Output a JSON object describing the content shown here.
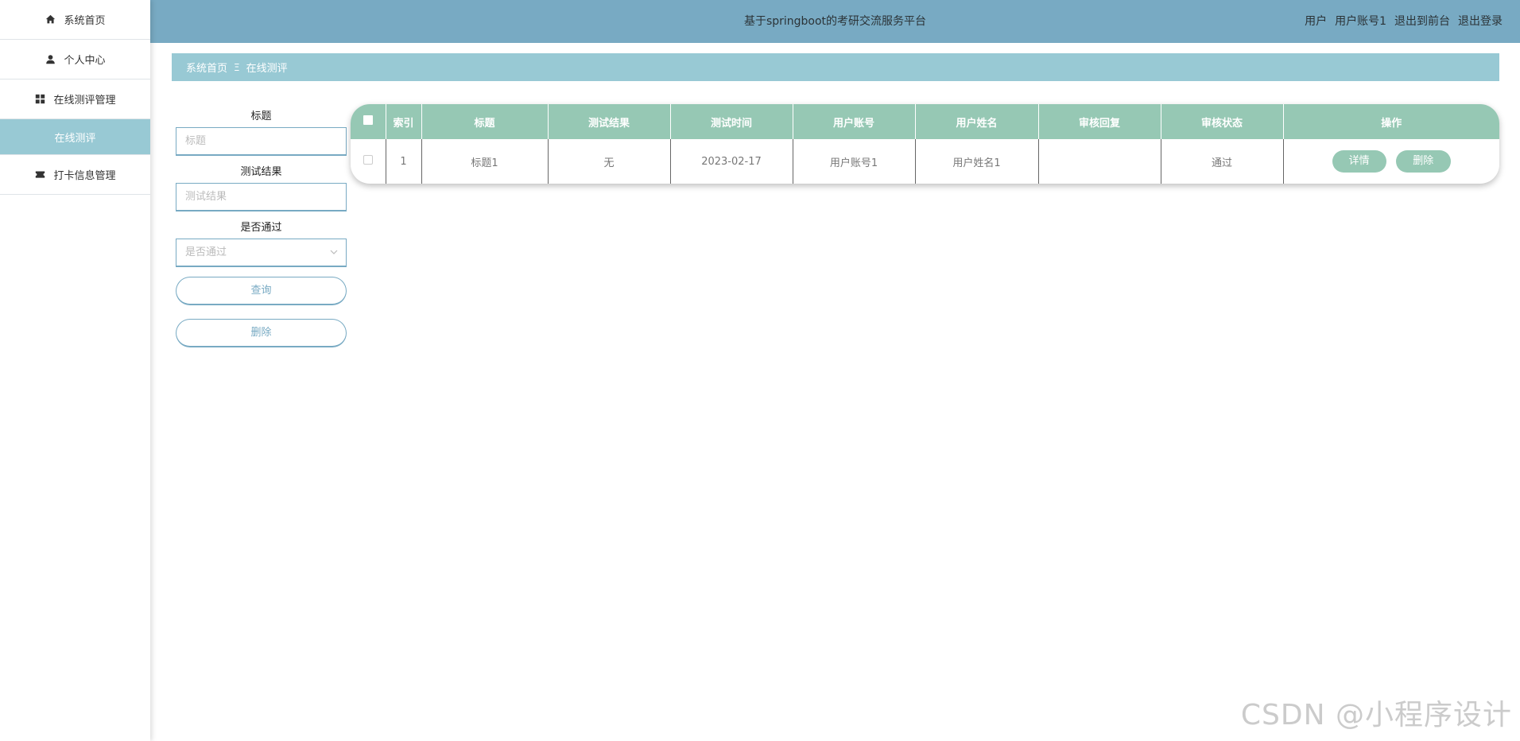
{
  "sidebar": {
    "items": [
      {
        "label": "系统首页",
        "icon": "home-icon"
      },
      {
        "label": "个人中心",
        "icon": "user-icon"
      },
      {
        "label": "在线测评管理",
        "icon": "grid-icon"
      },
      {
        "label": "在线测评",
        "icon": "",
        "active": true
      },
      {
        "label": "打卡信息管理",
        "icon": "ticket-icon"
      }
    ]
  },
  "header": {
    "title": "基于springboot的考研交流服务平台",
    "role": "用户",
    "account": "用户账号1",
    "to_front": "退出到前台",
    "logout": "退出登录"
  },
  "breadcrumb": {
    "home": "系统首页",
    "separator": "Ξ",
    "current": "在线测评"
  },
  "search": {
    "title_label": "标题",
    "title_placeholder": "标题",
    "result_label": "测试结果",
    "result_placeholder": "测试结果",
    "pass_label": "是否通过",
    "pass_placeholder": "是否通过",
    "query_button": "查询",
    "delete_button": "删除"
  },
  "table": {
    "columns": [
      "索引",
      "标题",
      "测试结果",
      "测试时间",
      "用户账号",
      "用户姓名",
      "审核回复",
      "审核状态",
      "操作"
    ],
    "rows": [
      {
        "index": "1",
        "title": "标题1",
        "result": "无",
        "time": "2023-02-17",
        "account": "用户账号1",
        "name": "用户姓名1",
        "reply": "",
        "status": "通过"
      }
    ],
    "detail_button": "详情",
    "delete_button": "删除"
  },
  "watermark": "CSDN @小程序设计",
  "colors": {
    "topbar": "#78aac3",
    "breadcrumb": "#98c9d4",
    "table_header": "#96c8b4",
    "sidebar_active": "#98c9d4"
  }
}
